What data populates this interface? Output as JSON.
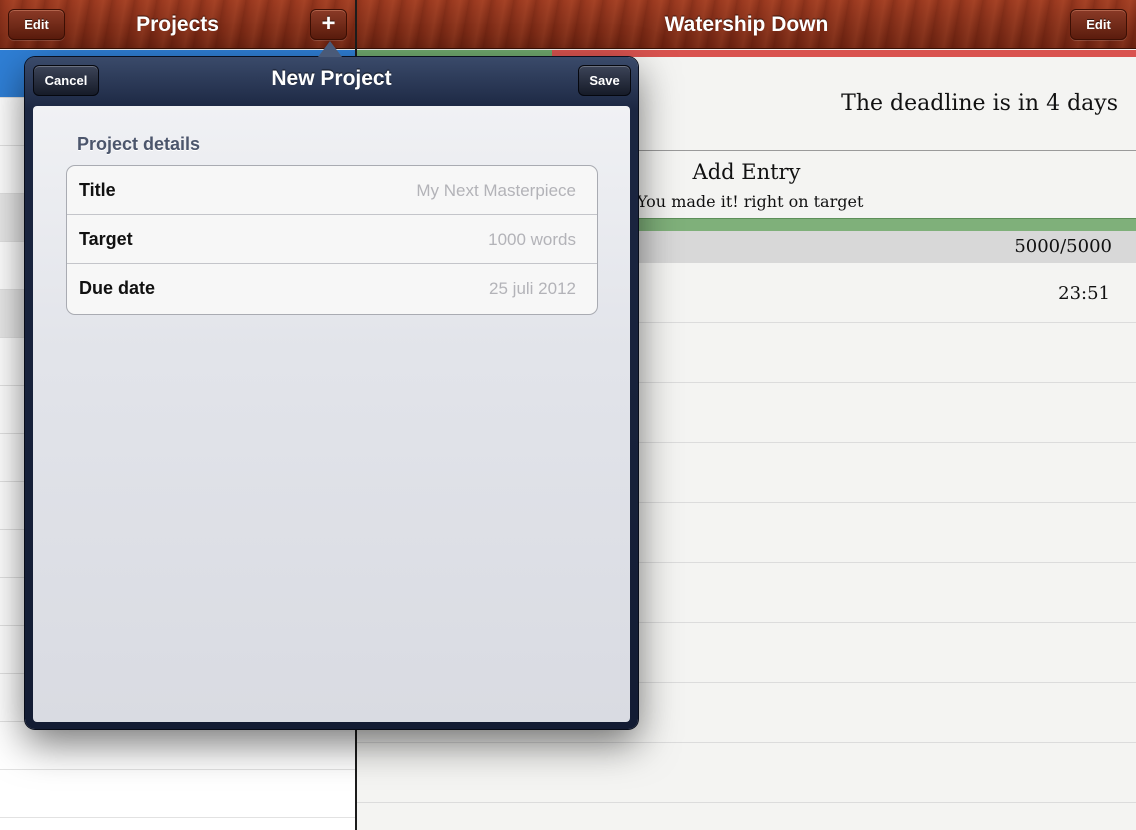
{
  "left_header": {
    "edit_label": "Edit",
    "title": "Projects",
    "add_label": "+"
  },
  "right_header": {
    "title": "Watership Down",
    "edit_label": "Edit"
  },
  "detail": {
    "progress_fraction": 0.25,
    "deadline_text": "The deadline is in 4 days",
    "add_entry_label": "Add Entry",
    "status_text": "You made it! right on target",
    "word_count": "5000/5000",
    "entry_time": "23:51"
  },
  "popover": {
    "title": "New Project",
    "cancel_label": "Cancel",
    "save_label": "Save",
    "section_header": "Project details",
    "fields": [
      {
        "label": "Title",
        "placeholder": "My Next Masterpiece"
      },
      {
        "label": "Target",
        "placeholder": "1000 words"
      },
      {
        "label": "Due date",
        "placeholder": "25 juli 2012"
      }
    ]
  },
  "colors": {
    "wood": "#86301a",
    "progress_green": "#6fa86d",
    "progress_red": "#d9534f",
    "popover_navy": "#131c33",
    "section_header": "#4c566c",
    "placeholder": "#b3b3b8"
  },
  "icons": {
    "add": "plus-icon"
  }
}
